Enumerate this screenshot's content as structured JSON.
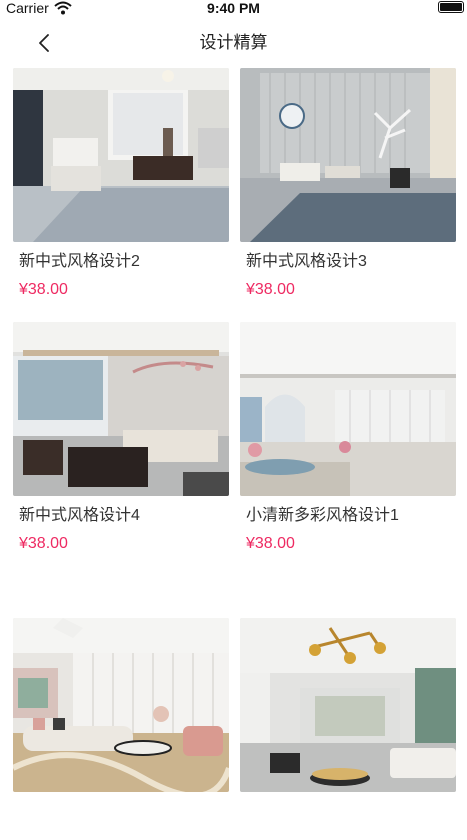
{
  "status_bar": {
    "carrier": "Carrier",
    "time": "9:40 PM"
  },
  "nav": {
    "title": "设计精算"
  },
  "colors": {
    "price": "#ee2a62"
  },
  "products": [
    {
      "name": "新中式风格设计2",
      "price": "¥38.00"
    },
    {
      "name": "新中式风格设计3",
      "price": "¥38.00"
    },
    {
      "name": "新中式风格设计4",
      "price": "¥38.00"
    },
    {
      "name": "小清新多彩风格设计1",
      "price": "¥38.00"
    },
    {
      "name": "",
      "price": ""
    },
    {
      "name": "",
      "price": ""
    }
  ]
}
